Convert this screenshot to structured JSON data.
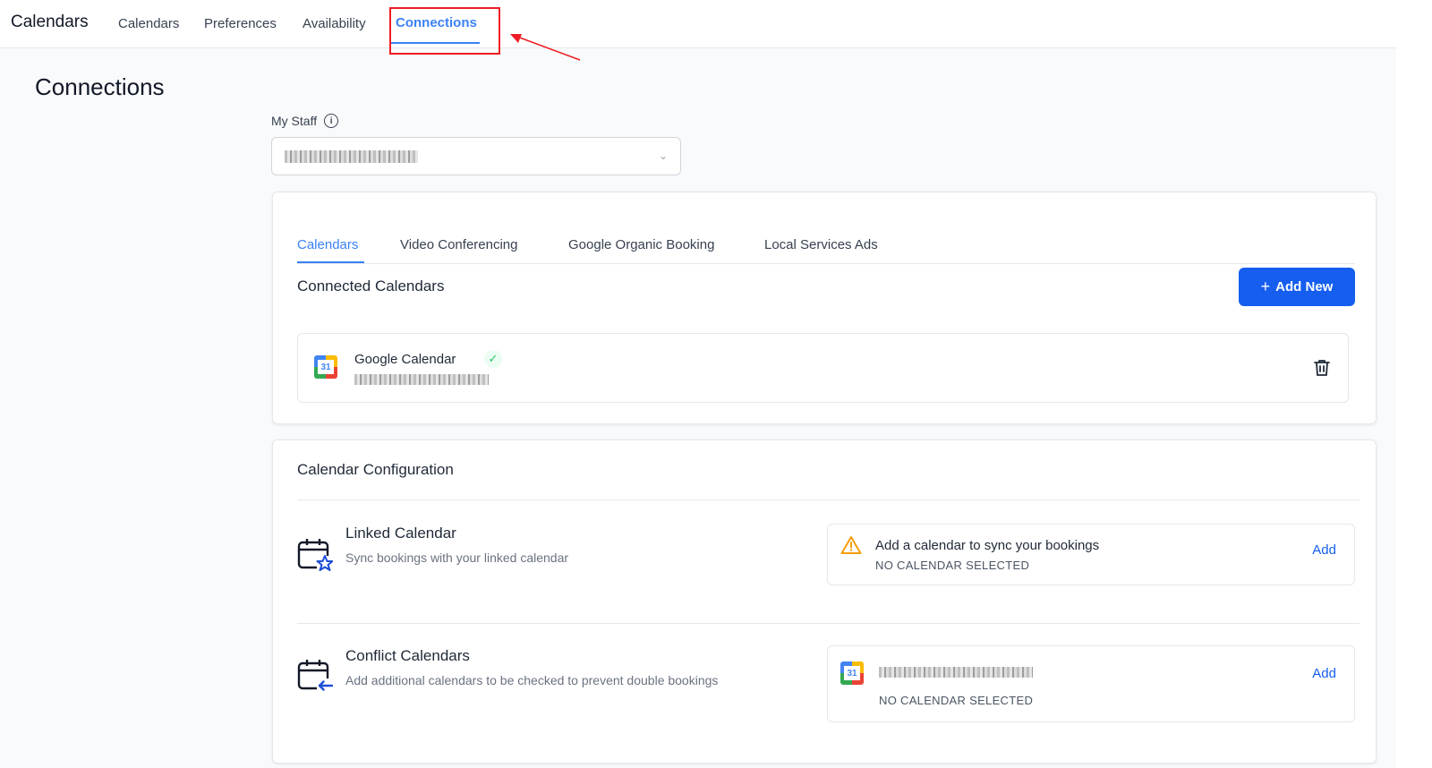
{
  "app": {
    "title": "Calendars"
  },
  "nav": {
    "tabs": [
      {
        "label": "Calendars"
      },
      {
        "label": "Preferences"
      },
      {
        "label": "Availability"
      },
      {
        "label": "Connections",
        "active": true
      }
    ]
  },
  "page": {
    "title": "Connections"
  },
  "staff": {
    "label": "My Staff",
    "selected_value": "",
    "value_redacted": true
  },
  "subtabs": [
    {
      "label": "Calendars",
      "active": true
    },
    {
      "label": "Video Conferencing"
    },
    {
      "label": "Google Organic Booking"
    },
    {
      "label": "Local Services Ads"
    }
  ],
  "connected": {
    "heading": "Connected Calendars",
    "add_new_label": "Add New",
    "items": [
      {
        "name": "Google Calendar",
        "account": "",
        "account_redacted": true,
        "status_icon": "check-icon",
        "logo_day": "31"
      }
    ]
  },
  "config": {
    "heading": "Calendar Configuration",
    "linked": {
      "title": "Linked Calendar",
      "description": "Sync bookings with your linked calendar",
      "status_main": "Add a calendar to sync your bookings",
      "status_sub": "NO CALENDAR SELECTED",
      "action": "Add"
    },
    "conflict": {
      "title": "Conflict Calendars",
      "description": "Add additional calendars to be checked to prevent double bookings",
      "calendar_redacted": true,
      "logo_day": "31",
      "status_sub": "NO CALENDAR SELECTED",
      "action": "Add"
    }
  },
  "colors": {
    "accent": "#3b82f6",
    "primary_button": "#155eef",
    "highlight_annotation": "#ee1c24",
    "warning": "#f59e0b",
    "success": "#22c55e"
  }
}
